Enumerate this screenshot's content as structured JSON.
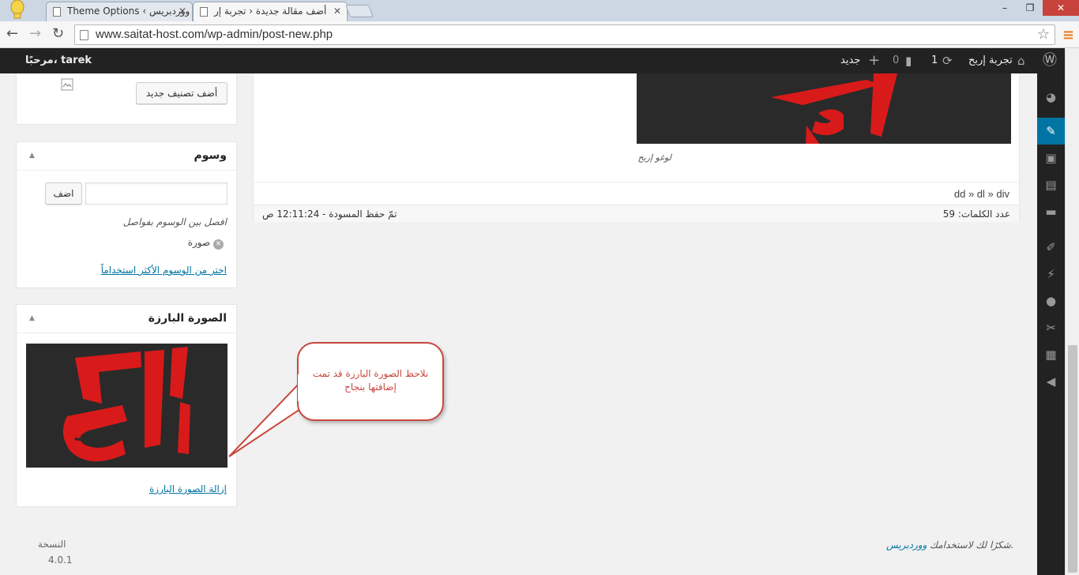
{
  "browser": {
    "tabs": [
      {
        "label": "Theme Options ‹ ووردبريس"
      },
      {
        "label": "أضف مقالة جديدة ‹ تجربة إر"
      }
    ],
    "url": "www.saitat-host.com/wp-admin/post-new.php",
    "window_controls": {
      "minimize": "–",
      "maximize": "❐",
      "close": "✕"
    }
  },
  "adminbar": {
    "greeting": "مرحبًا، tarek",
    "site_name": "تجربة إربح",
    "updates_count": "1",
    "comments_count": "0",
    "new_label": "جديد"
  },
  "admin_menu": {
    "icons": [
      "wordpress-icon",
      "dashboard-icon",
      "posts-icon",
      "media-icon",
      "pages-icon",
      "comments-icon",
      "appearance-icon",
      "plugins-icon",
      "users-icon",
      "tools-icon",
      "settings-icon",
      "collapse-icon"
    ]
  },
  "categories_box": {
    "add_new_button": "أضف تصنيف جديد"
  },
  "tags_box": {
    "title": "وسوم",
    "add_button": "اضف",
    "hint": "افصل بين الوسوم بفواصل",
    "tags": [
      {
        "label": "صورة"
      }
    ],
    "most_used_link": "اختر من الوسوم الأكثر استخداماً"
  },
  "featured_image_box": {
    "title": "الصورة البارزة",
    "remove_link": "إزالة الصورة البارزة"
  },
  "editor": {
    "image_caption": "لوغو إربح",
    "path": "dd » dl » div",
    "word_count": "عدد الكلمات: 59",
    "draft_saved": "تمّ حفظ المسودة - 12:11:24 ص"
  },
  "callout": {
    "text": "نلاحظ الصورة البارزة قد تمت إضافتها بنجاح"
  },
  "footer": {
    "thanks_prefix": "شكرًا لك لاستخدامك ",
    "thanks_link": "ووردبريس",
    "thanks_suffix": ".",
    "version_label": "النسخة",
    "version_number": "4.0.1"
  },
  "colors": {
    "admin_dark": "#222222",
    "accent_blue": "#0074a2",
    "callout_red": "#c9473f",
    "logo_red": "#d91a1a"
  }
}
